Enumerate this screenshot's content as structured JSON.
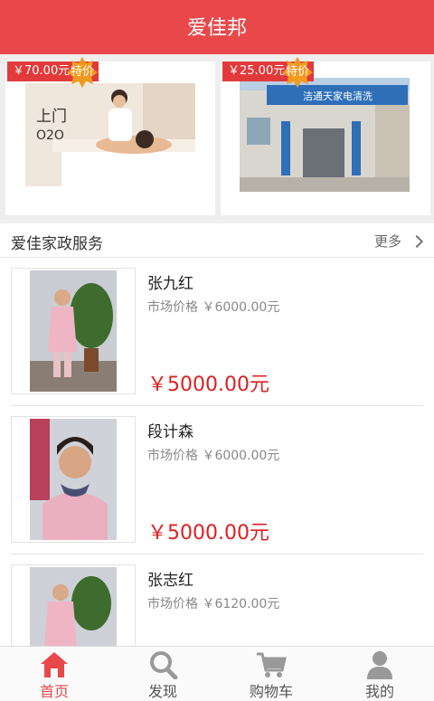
{
  "header": {
    "title": "爱佳邦"
  },
  "promos": [
    {
      "price": "￥70.00元",
      "badge": "特价",
      "image_text_1": "上门",
      "image_text_2": "O2O"
    },
    {
      "price": "￥25.00元",
      "badge": "特价",
      "image_text_1": "洁通天家电清洗"
    }
  ],
  "section": {
    "title": "爱佳家政服务",
    "more_label": "更多"
  },
  "items": [
    {
      "name": "张九红",
      "market_price": "市场价格 ￥6000.00元",
      "price": "￥5000.00元"
    },
    {
      "name": "段计森",
      "market_price": "市场价格 ￥6000.00元",
      "price": "￥5000.00元"
    },
    {
      "name": "张志红",
      "market_price": "市场价格 ￥6120.00元",
      "price": ""
    }
  ],
  "tabs": [
    {
      "label": "首页",
      "icon": "home-icon",
      "active": true
    },
    {
      "label": "发现",
      "icon": "search-icon",
      "active": false
    },
    {
      "label": "购物车",
      "icon": "cart-icon",
      "active": false
    },
    {
      "label": "我的",
      "icon": "user-icon",
      "active": false
    }
  ],
  "colors": {
    "brand": "#e8484a",
    "price": "#e02020",
    "badge": "#f39a1e"
  }
}
